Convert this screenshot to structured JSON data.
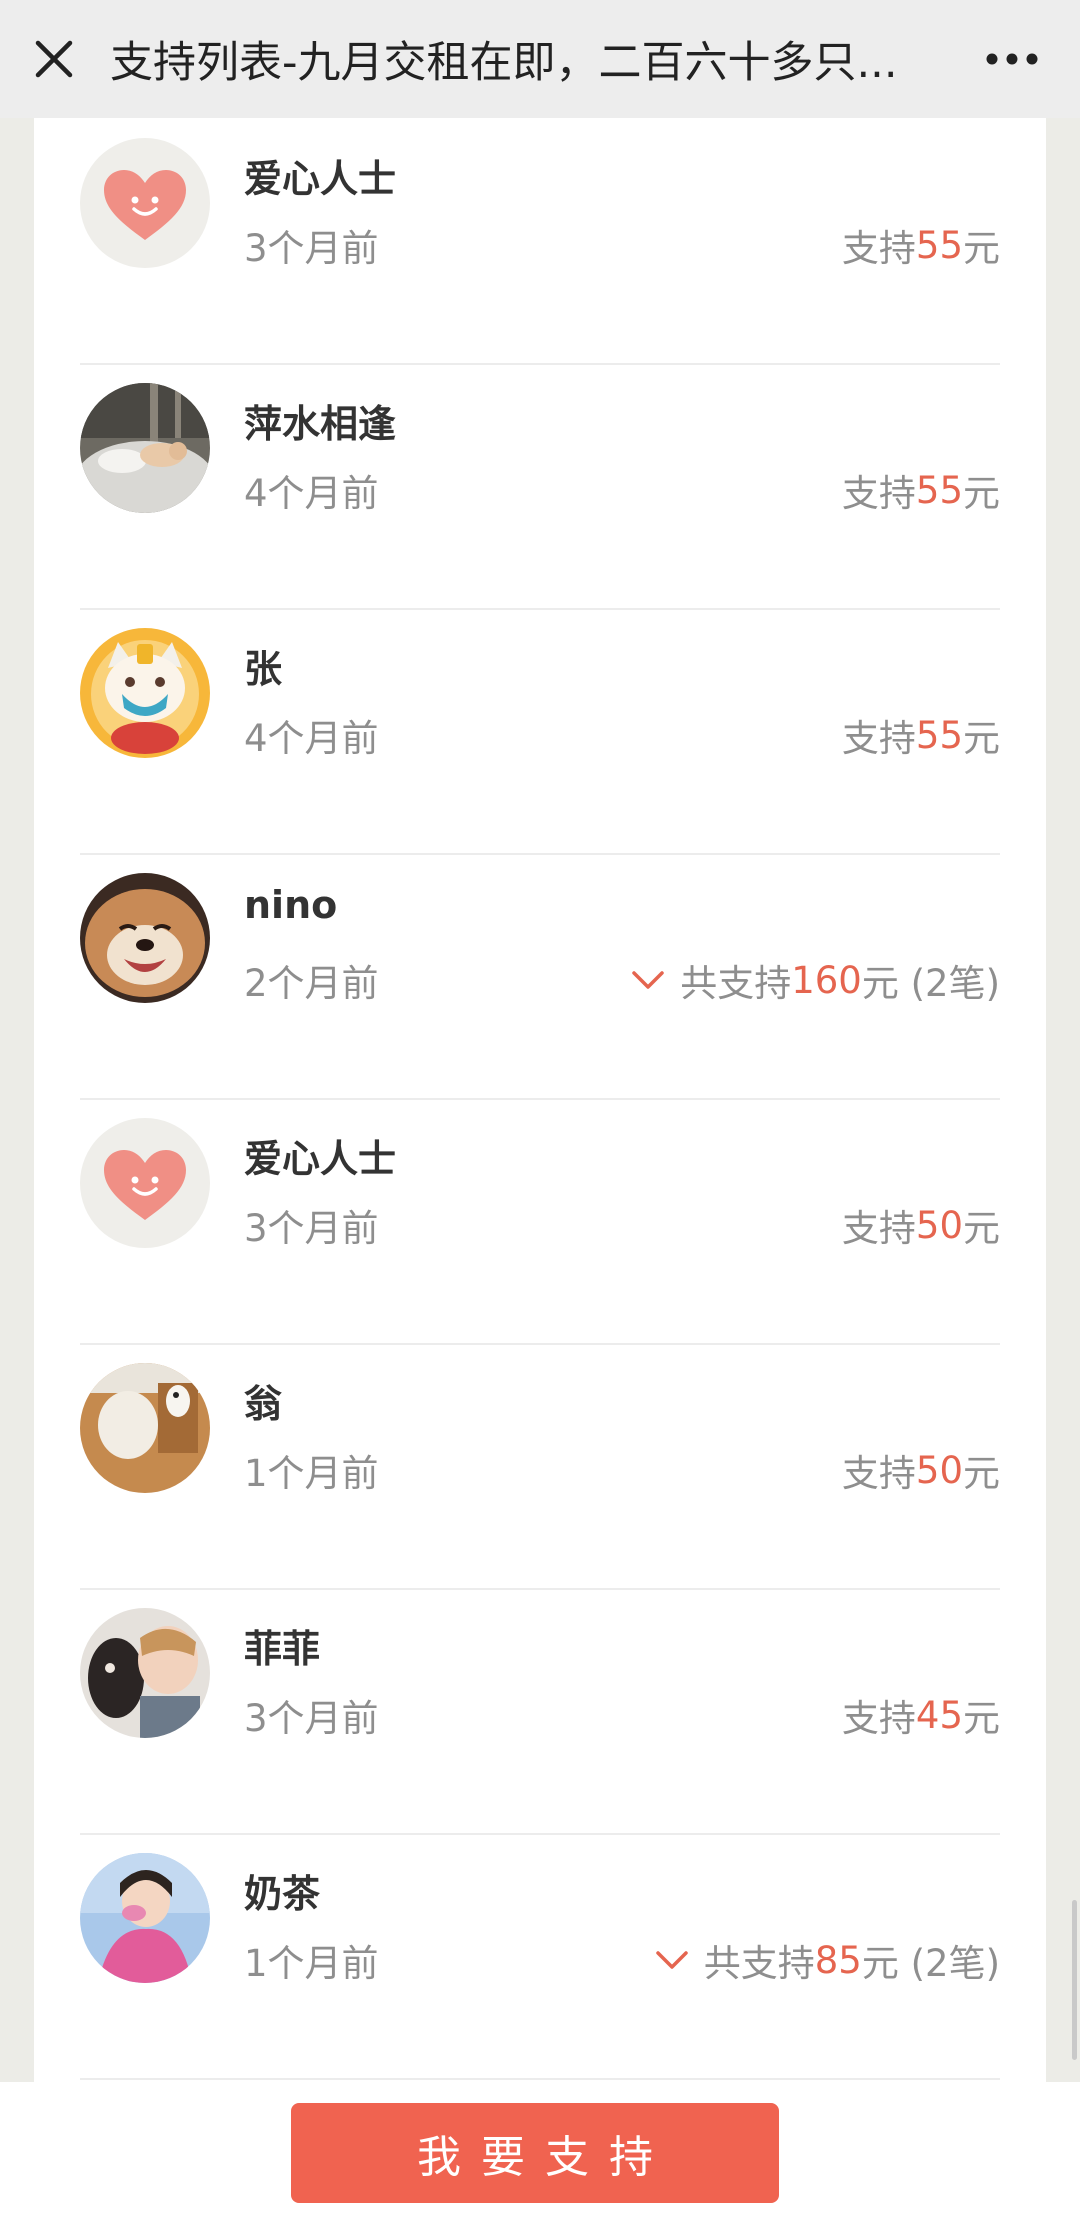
{
  "navbar": {
    "title": "支持列表-九月交租在即，二百六十多只...",
    "close_icon": "close-icon",
    "more_icon": "more-icon"
  },
  "supporters": [
    {
      "name": "爱心人士",
      "time": "3个月前",
      "prefix": "支持",
      "amount": "55",
      "suffix": "元",
      "avatar": "heart-logo-avatar",
      "expandable": false
    },
    {
      "name": "萍水相逢",
      "time": "4个月前",
      "prefix": "支持",
      "amount": "55",
      "suffix": "元",
      "avatar": "cats-photo-avatar",
      "expandable": false
    },
    {
      "name": "张",
      "time": "4个月前",
      "prefix": "支持",
      "amount": "55",
      "suffix": "元",
      "avatar": "cartoon-cat-mask-avatar",
      "expandable": false
    },
    {
      "name": "nino",
      "time": "2个月前",
      "prefix": "共支持",
      "amount": "160",
      "suffix": "元 (2笔)",
      "avatar": "shiba-dog-avatar",
      "expandable": true
    },
    {
      "name": "爱心人士",
      "time": "3个月前",
      "prefix": "支持",
      "amount": "50",
      "suffix": "元",
      "avatar": "heart-logo-avatar",
      "expandable": false
    },
    {
      "name": "翁",
      "time": "1个月前",
      "prefix": "支持",
      "amount": "50",
      "suffix": "元",
      "avatar": "dogs-on-floor-avatar",
      "expandable": false
    },
    {
      "name": "菲菲",
      "time": "3个月前",
      "prefix": "支持",
      "amount": "45",
      "suffix": "元",
      "avatar": "child-with-dog-avatar",
      "expandable": false
    },
    {
      "name": "奶茶",
      "time": "1个月前",
      "prefix": "共支持",
      "amount": "85",
      "suffix": "元 (2笔)",
      "avatar": "girl-pink-sweater-avatar",
      "expandable": true
    }
  ],
  "bottom_bar": {
    "support_label": "我要支持"
  },
  "colors": {
    "accent": "#e5654f",
    "button": "#f06350",
    "navbar_bg": "#ededed",
    "page_bg": "#ecece7"
  }
}
